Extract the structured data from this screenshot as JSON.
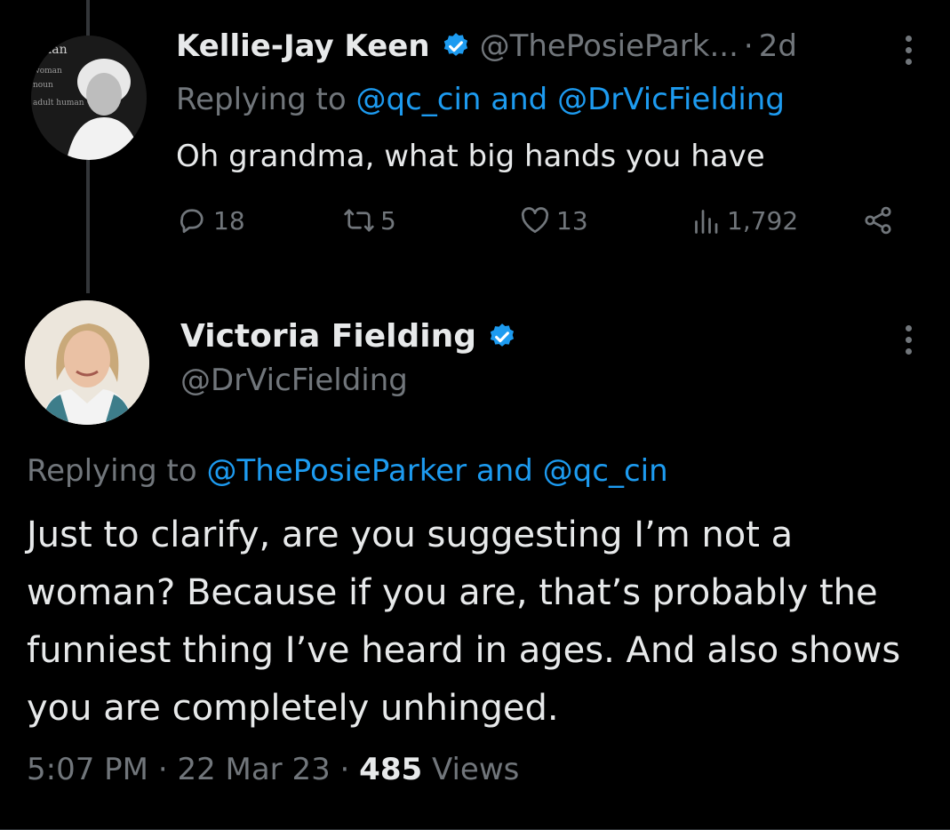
{
  "reply": {
    "avatar_text": [
      "man",
      "woman",
      "noun",
      "adult human"
    ],
    "name": "Kellie-Jay Keen",
    "handle": "@ThePosiePark...",
    "separator": "·",
    "time": "2d",
    "replying_prefix": "Replying to",
    "replying_mention_1": "@qc_cin",
    "replying_and": "and",
    "replying_mention_2": "@DrVicFielding",
    "text": "Oh grandma, what big hands you have",
    "actions": {
      "replies": "18",
      "reposts": "5",
      "likes": "13",
      "views": "1,792"
    }
  },
  "main": {
    "name": "Victoria Fielding",
    "handle": "@DrVicFielding",
    "replying_prefix": "Replying to",
    "replying_mention_1": "@ThePosieParker",
    "replying_and": "and",
    "replying_mention_2": "@qc_cin",
    "body": "Just to clarify, are you suggesting I’m not a woman? Because if you are, that’s probably the funniest thing I’ve heard in ages. And also shows you are completely unhinged.",
    "time": "5:07 PM",
    "separator": "·",
    "date": "22 Mar 23",
    "views_count": "485",
    "views_label": "Views"
  },
  "colors": {
    "background": "#000000",
    "text": "#e7e9ea",
    "secondary": "#71767b",
    "accent": "#1d9bf0"
  },
  "icons": [
    "verified-badge-icon",
    "more-icon",
    "reply-icon",
    "repost-icon",
    "like-icon",
    "views-icon",
    "share-icon"
  ]
}
